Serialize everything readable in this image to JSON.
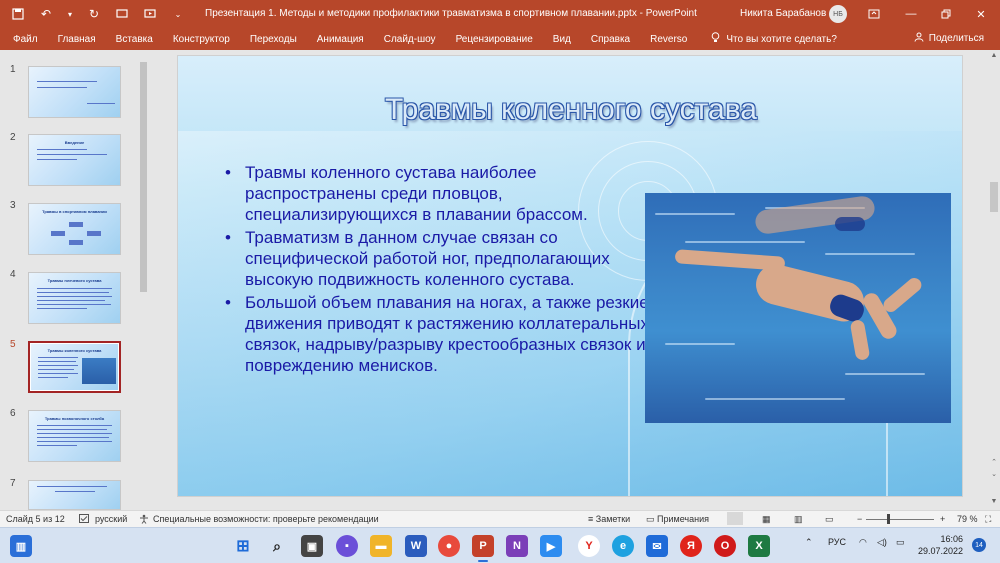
{
  "titlebar": {
    "title": "Презентация 1. Методы и методики профилактики травматизма в спортивном плавании.pptx  -  PowerPoint",
    "user": "Никита Барабанов",
    "avatar": "НБ"
  },
  "menu": {
    "items": [
      "Файл",
      "Главная",
      "Вставка",
      "Конструктор",
      "Переходы",
      "Анимация",
      "Слайд-шоу",
      "Рецензирование",
      "Вид",
      "Справка",
      "Reverso"
    ],
    "search_placeholder": "Что вы хотите сделать?",
    "share": "Поделиться"
  },
  "thumbnails": {
    "numbers": [
      "1",
      "2",
      "3",
      "4",
      "5",
      "6",
      "7"
    ],
    "selected": "5",
    "titles": [
      "",
      "Введение",
      "Травмы в спортивном плавании",
      "Травмы плечевого сустава",
      "Травмы коленного сустава",
      "Травмы позвоночного столба",
      ""
    ]
  },
  "slide": {
    "title": "Травмы коленного сустава",
    "bullets": [
      "Травмы коленного сустава наиболее распространены среди пловцов, специализирующихся в плавании брассом.",
      "Травматизм в данном случае связан со специфической работой ног, предполагающих высокую подвижность коленного сустава.",
      "Большой объем плавания на ногах, а также резкие движения приводят к растяжению коллатеральных связок, надрыву/разрыву крестообразных связок и повреждению менисков."
    ]
  },
  "statusbar": {
    "slide_of": "Слайд 5 из 12",
    "language": "русский",
    "accessibility": "Специальные возможности: проверьте рекомендации",
    "notes": "Заметки",
    "comments": "Примечания",
    "zoom": "79 %"
  },
  "taskbar": {
    "lang": "РУС",
    "time": "16:06",
    "date": "29.07.2022",
    "notifications": "14"
  }
}
